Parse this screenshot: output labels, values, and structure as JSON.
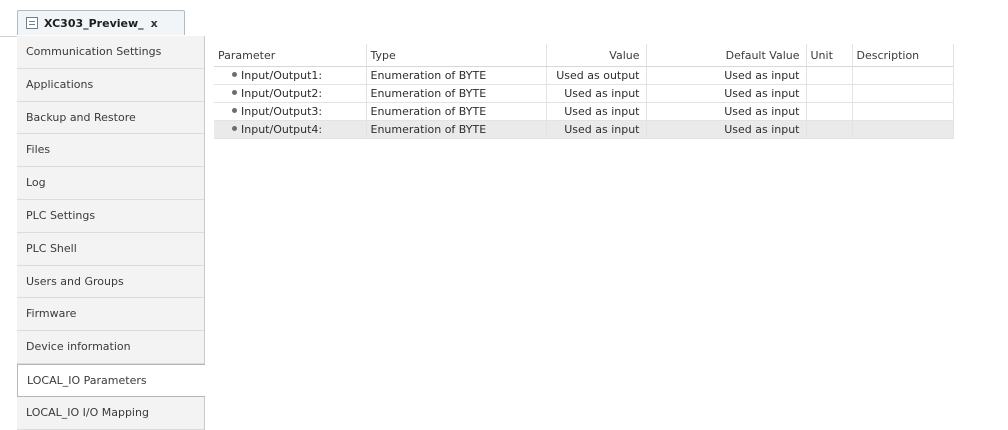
{
  "tab": {
    "title": "XC303_Preview_",
    "close_label": "x",
    "icon": "device-editor-icon"
  },
  "sidebar": {
    "items": [
      {
        "label": "Communication Settings"
      },
      {
        "label": "Applications"
      },
      {
        "label": "Backup and Restore"
      },
      {
        "label": "Files"
      },
      {
        "label": "Log"
      },
      {
        "label": "PLC Settings"
      },
      {
        "label": "PLC Shell"
      },
      {
        "label": "Users and Groups"
      },
      {
        "label": "Firmware"
      },
      {
        "label": "Device information"
      },
      {
        "label": "LOCAL_IO Parameters"
      },
      {
        "label": "LOCAL_IO I/O Mapping"
      }
    ],
    "selected": "LOCAL_IO Parameters"
  },
  "table": {
    "columns": [
      "Parameter",
      "Type",
      "Value",
      "Default Value",
      "Unit",
      "Description"
    ],
    "rows": [
      {
        "parameter": "Input/Output1:",
        "type": "Enumeration of BYTE",
        "value": "Used as output",
        "default": "Used as input",
        "unit": "",
        "description": ""
      },
      {
        "parameter": "Input/Output2:",
        "type": "Enumeration of BYTE",
        "value": "Used as input",
        "default": "Used as input",
        "unit": "",
        "description": ""
      },
      {
        "parameter": "Input/Output3:",
        "type": "Enumeration of BYTE",
        "value": "Used as input",
        "default": "Used as input",
        "unit": "",
        "description": ""
      },
      {
        "parameter": "Input/Output4:",
        "type": "Enumeration of BYTE",
        "value": "Used as input",
        "default": "Used as input",
        "unit": "",
        "description": ""
      }
    ],
    "selected_row": 3
  }
}
